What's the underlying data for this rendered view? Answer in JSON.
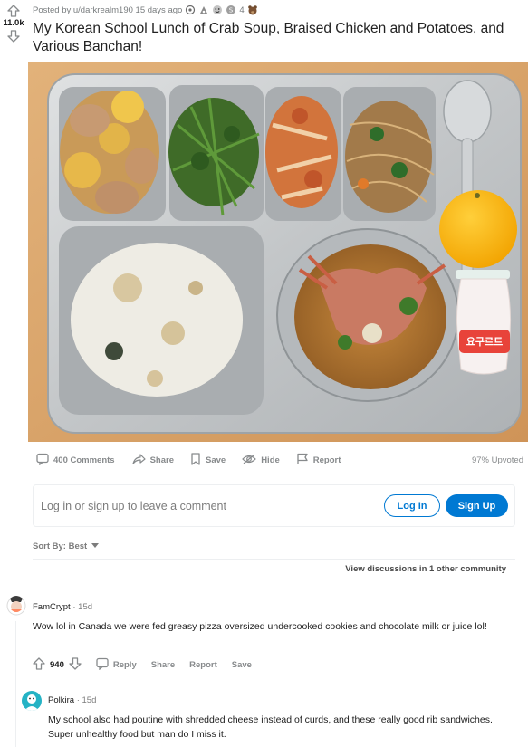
{
  "post": {
    "meta": "Posted by u/darkrealm190 15 days ago",
    "award_count": "4",
    "votes": "11.0k",
    "title": "My Korean School Lunch of Crab Soup, Braised Chicken and Potatoes, and Various Banchan!",
    "actions": {
      "comments": "400 Comments",
      "share": "Share",
      "save": "Save",
      "hide": "Hide",
      "report": "Report"
    },
    "upvoted": "97% Upvoted"
  },
  "yogurt_label": "요구르트",
  "login": {
    "prompt": "Log in or sign up to leave a comment",
    "login_label": "Log In",
    "signup_label": "Sign Up"
  },
  "sort": {
    "label": "Sort By: Best"
  },
  "other_communities": "View discussions in 1 other community",
  "comments": [
    {
      "author": "FamCrypt",
      "time": "15d",
      "body": "Wow lol in Canada we were fed greasy pizza oversized undercooked cookies and chocolate milk or juice lol!",
      "votes": "940",
      "reply": "Reply",
      "share": "Share",
      "report": "Report",
      "save": "Save"
    },
    {
      "author": "Polkira",
      "time": "15d",
      "body": "My school also had poutine with shredded cheese instead of curds, and these really good rib sandwiches. Super unhealthy food but man do I miss it."
    }
  ],
  "colors": {
    "accent": "#0079d3",
    "meta_text": "#787c7e",
    "tray_steel": "#c9ccce",
    "table_wood": "#d8a36a"
  }
}
